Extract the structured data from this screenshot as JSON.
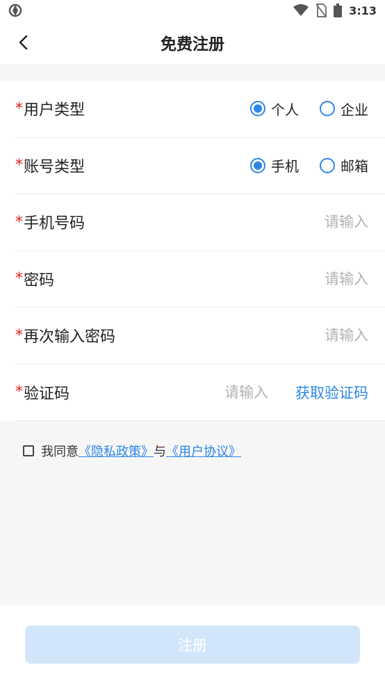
{
  "status_bar": {
    "time": "3:13"
  },
  "header": {
    "title": "免费注册",
    "back_icon": "chevron-left-icon"
  },
  "form": {
    "required_mark": "*",
    "user_type": {
      "label": "用户类型",
      "options": [
        "个人",
        "企业"
      ],
      "selected": "个人"
    },
    "account_type": {
      "label": "账号类型",
      "options": [
        "手机",
        "邮箱"
      ],
      "selected": "手机"
    },
    "phone": {
      "label": "手机号码",
      "placeholder": "请输入"
    },
    "password": {
      "label": "密码",
      "placeholder": "请输入"
    },
    "password_confirm": {
      "label": "再次输入密码",
      "placeholder": "请输入"
    },
    "code": {
      "label": "验证码",
      "placeholder": "请输入",
      "get_code_label": "获取验证码"
    }
  },
  "agreement": {
    "prefix": "我同意",
    "privacy_link": "《隐私政策》",
    "joiner": "与",
    "user_agreement_link": "《用户协议》",
    "checked": false
  },
  "submit": {
    "label": "注册"
  },
  "colors": {
    "accent": "#2b86e6",
    "required": "#e02020",
    "button_disabled": "#d2e6fb"
  }
}
